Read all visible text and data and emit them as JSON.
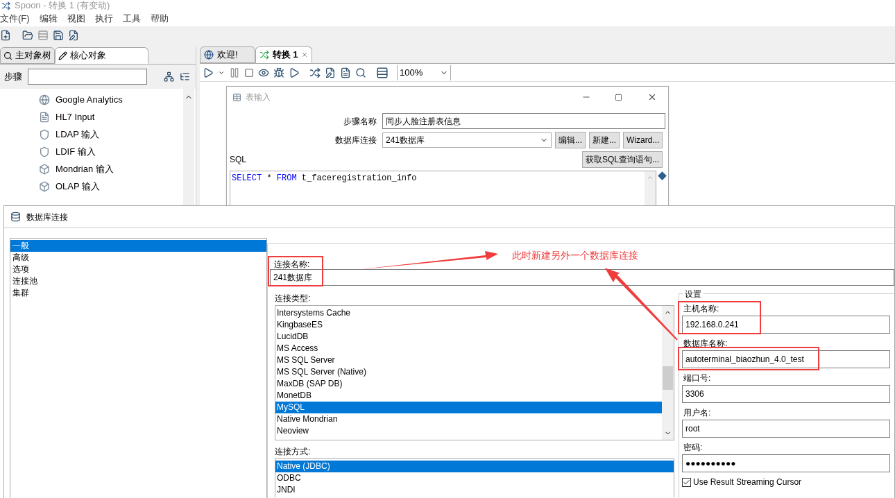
{
  "app": {
    "title": "Spoon - 转换 1 (有变动)",
    "menu": [
      "文件(F)",
      "编辑",
      "视图",
      "执行",
      "工具",
      "帮助"
    ]
  },
  "left_panel": {
    "tabs": [
      {
        "label": "主对象树",
        "selected": false
      },
      {
        "label": "核心对象",
        "selected": true
      }
    ],
    "search_label": "步骤",
    "steps": [
      "Google Analytics",
      "HL7 Input",
      "LDAP 输入",
      "LDIF 输入",
      "Mondrian 输入",
      "OLAP 输入"
    ]
  },
  "editor": {
    "tabs": [
      {
        "label": "欢迎!",
        "selected": false
      },
      {
        "label": "转换 1",
        "selected": true
      }
    ],
    "zoom": "100%"
  },
  "table_input_dialog": {
    "title": "表输入",
    "step_name_label": "步骤名称",
    "step_name": "同步人脸注册表信息",
    "connection_label": "数据库连接",
    "connection": "241数据库",
    "buttons": [
      "编辑...",
      "新建...",
      "Wizard..."
    ],
    "sql_label": "SQL",
    "get_sql_button": "获取SQL查询语句...",
    "sql": [
      {
        "kind": "keyword",
        "text": "SELECT"
      },
      {
        "kind": "plain",
        "text": " * "
      },
      {
        "kind": "keyword",
        "text": "FROM"
      },
      {
        "kind": "plain",
        "text": " t_faceregistration_info"
      }
    ]
  },
  "db_dialog": {
    "title": "数据库连接",
    "sections": [
      {
        "label": "一般",
        "selected": true
      },
      {
        "label": "高级",
        "selected": false
      },
      {
        "label": "选项",
        "selected": false
      },
      {
        "label": "连接池",
        "selected": false
      },
      {
        "label": "集群",
        "selected": false
      }
    ],
    "connection_name_label": "连接名称:",
    "connection_name": "241数据库",
    "connection_name_highlighted": true,
    "type_label": "连接类型:",
    "types": [
      {
        "label": "Intersystems Cache",
        "selected": false
      },
      {
        "label": "KingbaseES",
        "selected": false
      },
      {
        "label": "LucidDB",
        "selected": false
      },
      {
        "label": "MS Access",
        "selected": false
      },
      {
        "label": "MS SQL Server",
        "selected": false
      },
      {
        "label": "MS SQL Server (Native)",
        "selected": false
      },
      {
        "label": "MaxDB (SAP DB)",
        "selected": false
      },
      {
        "label": "MonetDB",
        "selected": false
      },
      {
        "label": "MySQL",
        "selected": true
      },
      {
        "label": "Native Mondrian",
        "selected": false
      },
      {
        "label": "Neoview",
        "selected": false
      }
    ],
    "access_label": "连接方式:",
    "access": [
      {
        "label": "Native (JDBC)",
        "selected": true
      },
      {
        "label": "ODBC",
        "selected": false
      },
      {
        "label": "JNDI",
        "selected": false
      }
    ],
    "settings": {
      "title": "设置",
      "fields": [
        {
          "label": "主机名称:",
          "value": "192.168.0.241",
          "highlighted": true
        },
        {
          "label": "数据库名称:",
          "value": "autoterminal_biaozhun_4.0_test",
          "highlighted": true
        },
        {
          "label": "端口号:",
          "value": "3306",
          "highlighted": false
        },
        {
          "label": "用户名:",
          "value": "root",
          "highlighted": false
        },
        {
          "label": "密码:",
          "value": "●●●●●●●●●●",
          "highlighted": false
        }
      ],
      "streaming": {
        "label": "Use Result Streaming Cursor",
        "checked": true
      }
    }
  },
  "annotation": {
    "text": "此时新建另外一个数据库连接"
  }
}
